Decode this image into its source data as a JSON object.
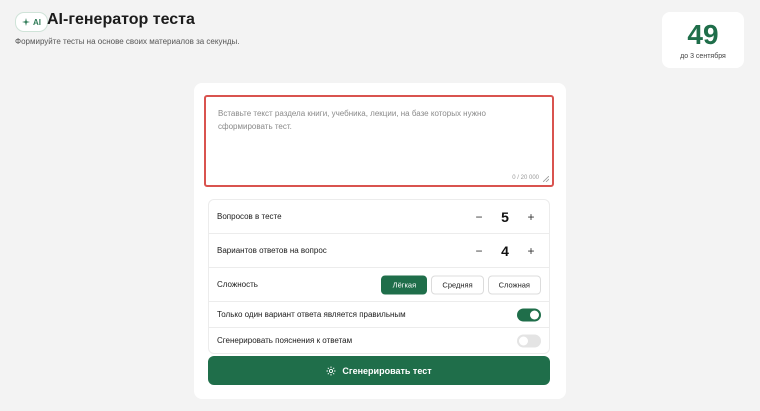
{
  "header": {
    "ai_badge": "AI",
    "title": "AI-генератор теста",
    "subtitle": "Формируйте тесты на основе своих материалов за секунды."
  },
  "counter": {
    "value": "49",
    "caption": "до 3 сентября"
  },
  "source": {
    "placeholder": "Вставьте текст раздела книги, учебника, лекции, на базе которых нужно сформировать тест.",
    "value": "",
    "char_count": "0 / 20 000"
  },
  "settings": {
    "questions": {
      "label": "Вопросов в тесте",
      "value": "5",
      "minus": "−",
      "plus": "+"
    },
    "answers": {
      "label": "Вариантов ответов на вопрос",
      "value": "4",
      "minus": "−",
      "plus": "+"
    },
    "difficulty": {
      "label": "Сложность",
      "options": [
        "Лёгкая",
        "Средняя",
        "Сложная"
      ],
      "selected": "Лёгкая"
    },
    "single_correct": {
      "label": "Только один вариант ответа является правильным",
      "enabled": true
    },
    "explanations": {
      "label": "Сгенерировать пояснения к ответам",
      "enabled": false
    }
  },
  "actions": {
    "generate_label": "Сгенерировать тест"
  },
  "colors": {
    "accent": "#1f6e4a",
    "error_border": "#d9534f",
    "background": "#f3f3f3"
  },
  "icons": {
    "badge": "sparkle-icon",
    "generate": "sparkle-icon",
    "resize": "resize-grip-icon"
  }
}
